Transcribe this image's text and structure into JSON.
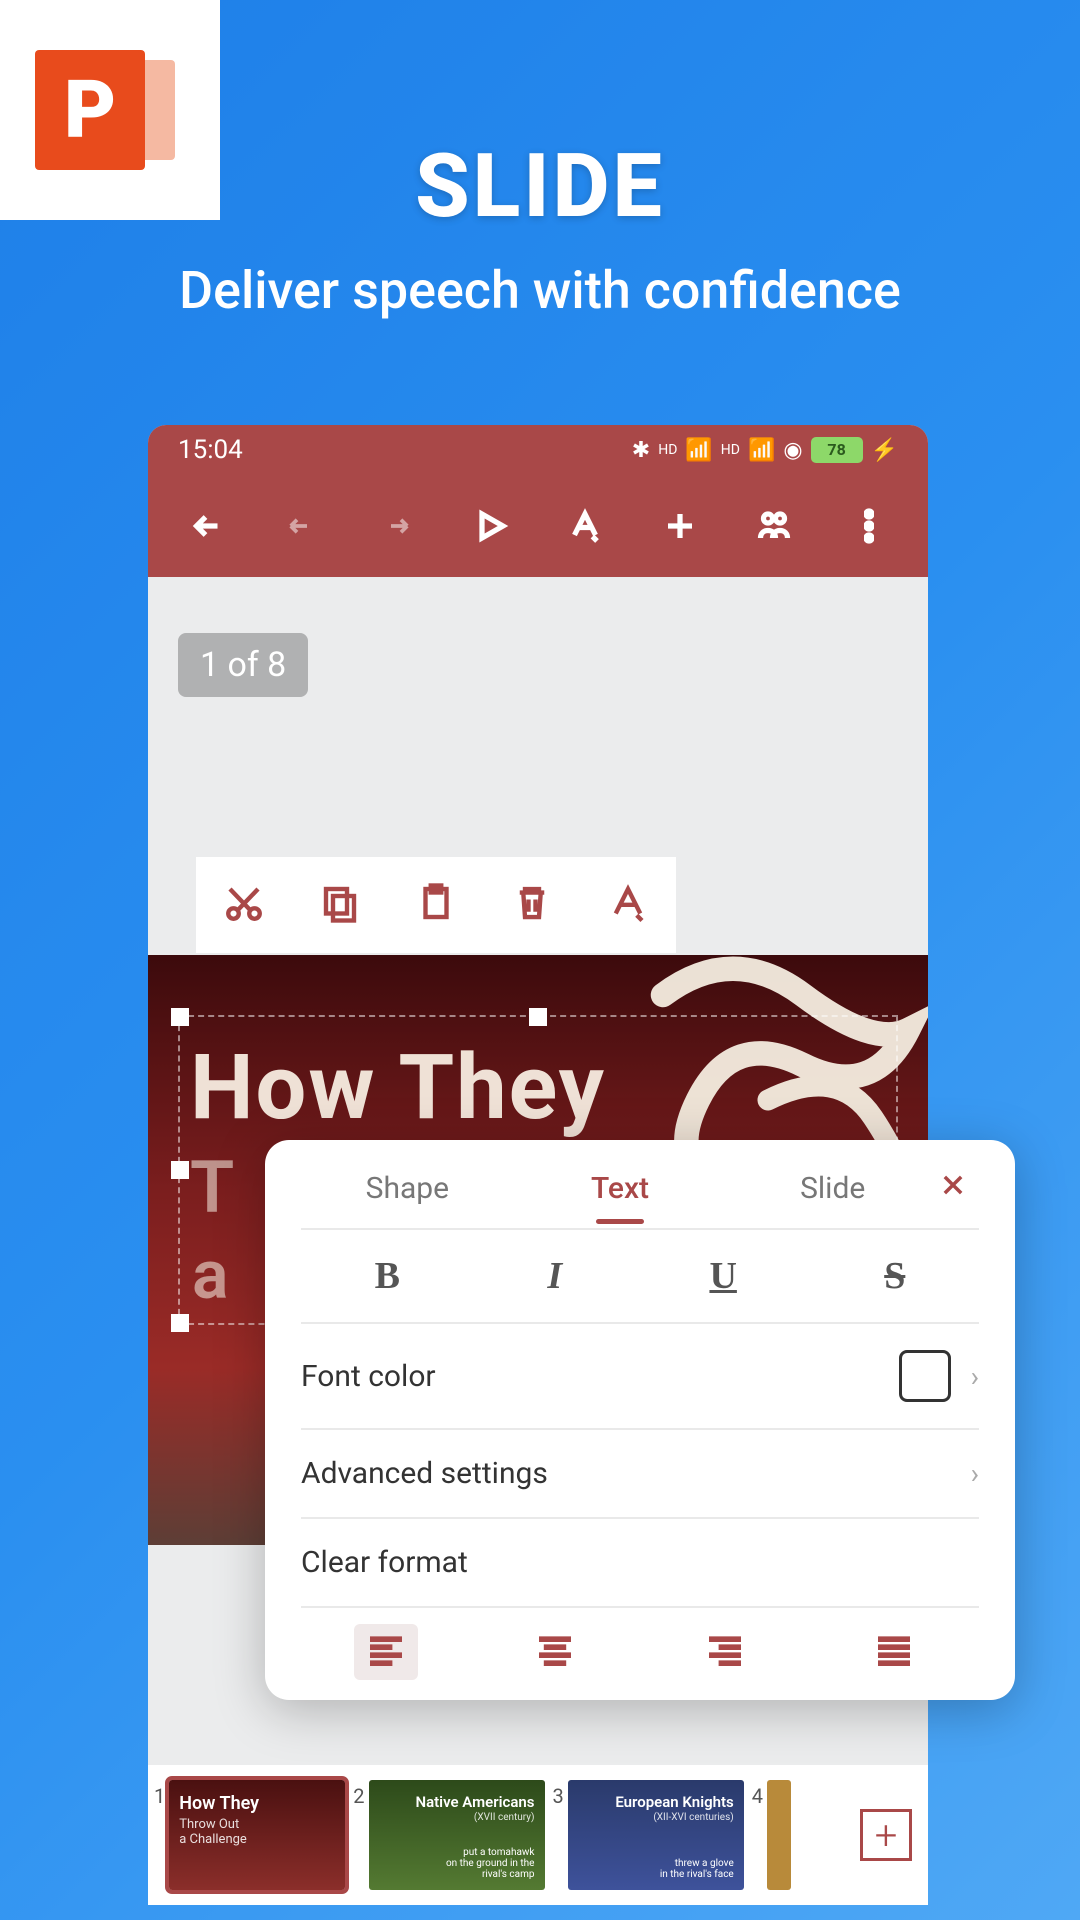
{
  "promo": {
    "title": "SLIDE",
    "subtitle": "Deliver speech with confidence",
    "icon_letter": "P"
  },
  "status": {
    "time": "15:04",
    "battery": "78"
  },
  "canvas": {
    "page_indicator": "1 of 8",
    "slide_title": "How They",
    "slide_sub1": "T",
    "slide_sub2": "a"
  },
  "sheet": {
    "tabs": {
      "shape": "Shape",
      "text": "Text",
      "slide": "Slide"
    },
    "items": {
      "font_color": "Font color",
      "advanced": "Advanced settings",
      "clear": "Clear format"
    }
  },
  "thumbnails": [
    {
      "num": "1",
      "title": "How They",
      "sub": "Throw Out\na Challenge",
      "desc": ""
    },
    {
      "num": "2",
      "title": "Native Americans",
      "sub": "(XVII century)",
      "desc": "put a tomahawk\non the ground in the\nrival's camp"
    },
    {
      "num": "3",
      "title": "European Knights",
      "sub": "(XII-XVI centuries)",
      "desc": "threw a glove\nin the rival's face"
    },
    {
      "num": "4",
      "title": "",
      "sub": "",
      "desc": ""
    }
  ]
}
